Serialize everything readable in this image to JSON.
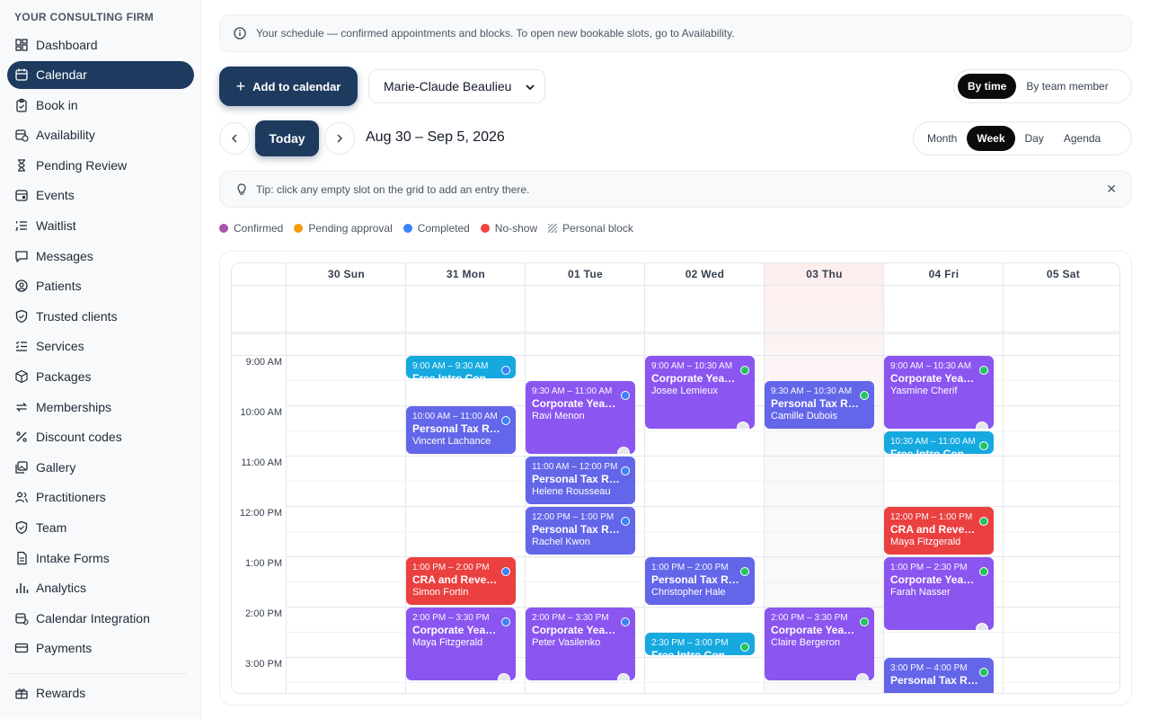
{
  "brand": "YOUR CONSULTING FIRM",
  "nav": [
    {
      "key": "dashboard",
      "label": "Dashboard",
      "icon": "dashboard-icon"
    },
    {
      "key": "calendar",
      "label": "Calendar",
      "icon": "calendar-icon",
      "active": true
    },
    {
      "key": "book-in",
      "label": "Book in",
      "icon": "clipboard-icon"
    },
    {
      "key": "availability",
      "label": "Availability",
      "icon": "calendar-clock-icon"
    },
    {
      "key": "pending-review",
      "label": "Pending Review",
      "icon": "hourglass-icon"
    },
    {
      "key": "events",
      "label": "Events",
      "icon": "calendar-event-icon"
    },
    {
      "key": "waitlist",
      "label": "Waitlist",
      "icon": "list-ordered-icon"
    },
    {
      "key": "messages",
      "label": "Messages",
      "icon": "message-icon"
    },
    {
      "key": "patients",
      "label": "Patients",
      "icon": "user-circle-icon"
    },
    {
      "key": "trusted-clients",
      "label": "Trusted clients",
      "icon": "shield-check-icon"
    },
    {
      "key": "services",
      "label": "Services",
      "icon": "list-check-icon"
    },
    {
      "key": "packages",
      "label": "Packages",
      "icon": "package-icon"
    },
    {
      "key": "memberships",
      "label": "Memberships",
      "icon": "repeat-icon"
    },
    {
      "key": "discount-codes",
      "label": "Discount codes",
      "icon": "percent-icon"
    },
    {
      "key": "gallery",
      "label": "Gallery",
      "icon": "gallery-icon"
    },
    {
      "key": "practitioners",
      "label": "Practitioners",
      "icon": "users-icon"
    },
    {
      "key": "team",
      "label": "Team",
      "icon": "shield-icon"
    },
    {
      "key": "intake-forms",
      "label": "Intake Forms",
      "icon": "file-icon"
    },
    {
      "key": "analytics",
      "label": "Analytics",
      "icon": "bar-chart-icon"
    },
    {
      "key": "calendar-integration",
      "label": "Calendar Integration",
      "icon": "calendar-sync-icon"
    },
    {
      "key": "payments",
      "label": "Payments",
      "icon": "credit-card-icon"
    }
  ],
  "nav_bottom": [
    {
      "key": "rewards",
      "label": "Rewards",
      "icon": "gift-icon"
    }
  ],
  "banner": "Your schedule — confirmed appointments and blocks. To open new bookable slots, go to Availability.",
  "toolbar": {
    "add_label": "Add to calendar",
    "member_selected": "Marie-Claude Beaulieu",
    "view_options": [
      "By time",
      "By team member"
    ],
    "view_selected": "By time",
    "today_label": "Today",
    "range_title": "Aug 30 – Sep 5, 2026",
    "range_options": [
      "Month",
      "Week",
      "Day",
      "Agenda"
    ],
    "range_selected": "Week"
  },
  "tip": "Tip: click any empty slot on the grid to add an entry there.",
  "tip_close": "✕",
  "legend": [
    {
      "label": "Confirmed",
      "color": "#a855a8"
    },
    {
      "label": "Pending approval",
      "color": "#f59e0b"
    },
    {
      "label": "Completed",
      "color": "#3b82f6"
    },
    {
      "label": "No-show",
      "color": "#ef4444"
    },
    {
      "label": "Personal block",
      "hatch": true
    }
  ],
  "days": [
    "30 Sun",
    "31 Mon",
    "01 Tue",
    "02 Wed",
    "03 Thu",
    "04 Fri",
    "05 Sat"
  ],
  "today_index": 4,
  "times": [
    "9:00 AM",
    "10:00 AM",
    "11:00 AM",
    "12:00 PM",
    "1:00 PM",
    "2:00 PM",
    "3:00 PM"
  ],
  "events": [
    {
      "day": 1,
      "start": 9.0,
      "end": 9.5,
      "time": "9:00 AM – 9:30 AM",
      "title": "Free Intro Con…",
      "client": "",
      "color": "cyan",
      "status": "#3b82f6"
    },
    {
      "day": 1,
      "start": 10.0,
      "end": 11.0,
      "time": "10:00 AM – 11:00 AM",
      "title": "Personal Tax R…",
      "client": "Vincent Lachance",
      "color": "indigo",
      "status": "#3b82f6"
    },
    {
      "day": 1,
      "start": 13.0,
      "end": 14.0,
      "time": "1:00 PM – 2:00 PM",
      "title": "CRA and Reve…",
      "client": "Simon Fortin",
      "color": "red",
      "status": "#3b82f6"
    },
    {
      "day": 1,
      "start": 14.0,
      "end": 15.5,
      "time": "2:00 PM – 3:30 PM",
      "title": "Corporate Yea…",
      "client": "Maya Fitzgerald",
      "color": "purple",
      "status": "#3b82f6"
    },
    {
      "day": 2,
      "start": 9.5,
      "end": 11.0,
      "time": "9:30 AM – 11:00 AM",
      "title": "Corporate Yea…",
      "client": "Ravi Menon",
      "color": "purple",
      "status": "#3b82f6"
    },
    {
      "day": 2,
      "start": 11.0,
      "end": 12.0,
      "time": "11:00 AM – 12:00 PM",
      "title": "Personal Tax R…",
      "client": "Helene Rousseau",
      "color": "indigo",
      "status": "#3b82f6"
    },
    {
      "day": 2,
      "start": 12.0,
      "end": 13.0,
      "time": "12:00 PM – 1:00 PM",
      "title": "Personal Tax R…",
      "client": "Rachel Kwon",
      "color": "indigo",
      "status": "#3b82f6"
    },
    {
      "day": 2,
      "start": 14.0,
      "end": 15.5,
      "time": "2:00 PM – 3:30 PM",
      "title": "Corporate Yea…",
      "client": "Peter Vasilenko",
      "color": "purple",
      "status": "#3b82f6"
    },
    {
      "day": 3,
      "start": 9.0,
      "end": 10.5,
      "time": "9:00 AM – 10:30 AM",
      "title": "Corporate Yea…",
      "client": "Josee Lemieux",
      "color": "purple",
      "status": "#22c55e"
    },
    {
      "day": 3,
      "start": 13.0,
      "end": 14.0,
      "time": "1:00 PM – 2:00 PM",
      "title": "Personal Tax R…",
      "client": "Christopher Hale",
      "color": "indigo",
      "status": "#22c55e"
    },
    {
      "day": 3,
      "start": 14.5,
      "end": 15.0,
      "time": "2:30 PM – 3:00 PM",
      "title": "Free Intro Con…",
      "client": "",
      "color": "cyan",
      "status": "#22c55e"
    },
    {
      "day": 4,
      "start": 9.5,
      "end": 10.5,
      "time": "9:30 AM – 10:30 AM",
      "title": "Personal Tax R…",
      "client": "Camille Dubois",
      "color": "indigo",
      "status": "#22c55e"
    },
    {
      "day": 4,
      "start": 14.0,
      "end": 15.5,
      "time": "2:00 PM – 3:30 PM",
      "title": "Corporate Yea…",
      "client": "Claire Bergeron",
      "color": "purple",
      "status": "#22c55e"
    },
    {
      "day": 5,
      "start": 9.0,
      "end": 10.5,
      "time": "9:00 AM – 10:30 AM",
      "title": "Corporate Yea…",
      "client": "Yasmine Cherif",
      "color": "purple",
      "status": "#22c55e"
    },
    {
      "day": 5,
      "start": 10.5,
      "end": 11.0,
      "time": "10:30 AM – 11:00 AM",
      "title": "Free Intro Con…",
      "client": "",
      "color": "cyan",
      "status": "#22c55e"
    },
    {
      "day": 5,
      "start": 12.0,
      "end": 13.0,
      "time": "12:00 PM – 1:00 PM",
      "title": "CRA and Reve…",
      "client": "Maya Fitzgerald",
      "color": "red",
      "status": "#22c55e"
    },
    {
      "day": 5,
      "start": 13.0,
      "end": 14.5,
      "time": "1:00 PM – 2:30 PM",
      "title": "Corporate Yea…",
      "client": "Farah Nasser",
      "color": "purple",
      "status": "#22c55e"
    },
    {
      "day": 5,
      "start": 15.0,
      "end": 16.0,
      "time": "3:00 PM – 4:00 PM",
      "title": "Personal Tax R…",
      "client": "",
      "color": "indigo",
      "status": "#22c55e"
    }
  ]
}
